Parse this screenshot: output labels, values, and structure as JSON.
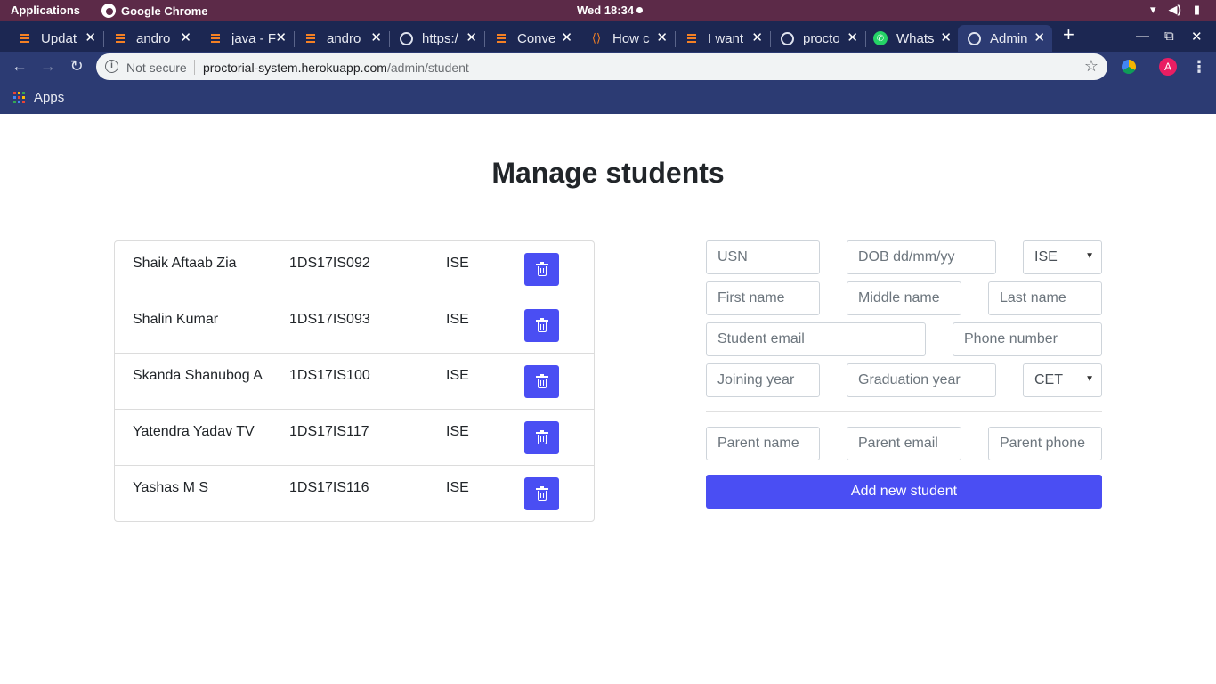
{
  "system_bar": {
    "applications_label": "Applications",
    "app_label": "Google Chrome",
    "clock": "Wed 18:34"
  },
  "browser": {
    "tabs": [
      {
        "title": "Updat",
        "icon": "stackoverflow-icon"
      },
      {
        "title": "andro",
        "icon": "stackoverflow-icon"
      },
      {
        "title": "java - F",
        "icon": "stackoverflow-icon"
      },
      {
        "title": "andro",
        "icon": "stackoverflow-icon"
      },
      {
        "title": "https:/",
        "icon": "globe-icon"
      },
      {
        "title": "Conve",
        "icon": "stackoverflow-icon"
      },
      {
        "title": "How c",
        "icon": "fire-icon"
      },
      {
        "title": "I want",
        "icon": "stackoverflow-icon"
      },
      {
        "title": "procto",
        "icon": "globe-icon"
      },
      {
        "title": "Whats",
        "icon": "whatsapp-icon"
      },
      {
        "title": "Admin",
        "icon": "globe-icon",
        "active": true
      }
    ],
    "address": {
      "security": "Not secure",
      "host": "proctorial-system.herokuapp.com",
      "path": "/admin/student"
    },
    "bookmarks": {
      "apps_label": "Apps"
    }
  },
  "page": {
    "title": "Manage students",
    "students": [
      {
        "name": "Shaik Aftaab Zia",
        "usn": "1DS17IS092",
        "dept": "ISE"
      },
      {
        "name": "Shalin Kumar",
        "usn": "1DS17IS093",
        "dept": "ISE"
      },
      {
        "name": "Skanda Shanubog A",
        "usn": "1DS17IS100",
        "dept": "ISE"
      },
      {
        "name": "Yatendra Yadav TV",
        "usn": "1DS17IS117",
        "dept": "ISE"
      },
      {
        "name": "Yashas M S",
        "usn": "1DS17IS116",
        "dept": "ISE"
      }
    ],
    "form": {
      "usn_placeholder": "USN",
      "dob_placeholder": "DOB dd/mm/yy",
      "department_selected": "ISE",
      "first_name_placeholder": "First name",
      "middle_name_placeholder": "Middle name",
      "last_name_placeholder": "Last name",
      "email_placeholder": "Student email",
      "phone_placeholder": "Phone number",
      "joining_year_placeholder": "Joining year",
      "graduation_year_placeholder": "Graduation year",
      "admission_selected": "CET",
      "parent_name_placeholder": "Parent name",
      "parent_email_placeholder": "Parent email",
      "parent_phone_placeholder": "Parent phone",
      "submit_label": "Add new student"
    },
    "colors": {
      "primary_button": "#4a4ef3",
      "system_bar": "#5c2a48",
      "browser_chrome": "#2c3b73"
    }
  }
}
